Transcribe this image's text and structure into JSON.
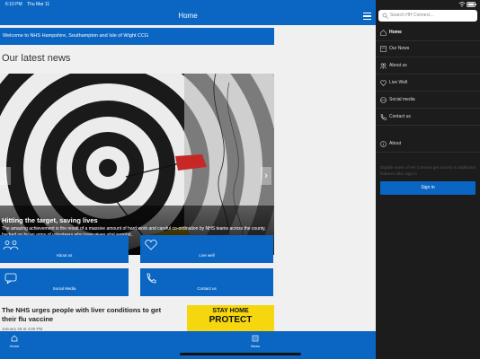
{
  "status": {
    "time": "6:10 PM",
    "date": "Thu Mar 11"
  },
  "navbar": {
    "title": "Home"
  },
  "welcome": "Welcome to NHS Hampshire, Southampton and Isle of Wight CCG",
  "section_title": "Our latest news",
  "hero": {
    "title": "Hitting the target, saving lives",
    "description": "The amazing achievement is the result of a massive amount of hard work and careful co-ordination by NHS teams across the county, backed up by an army of volunteers who have given vital support."
  },
  "tiles": {
    "about": "About us",
    "live": "Live well",
    "social": "Social Media",
    "contact": "Contact us"
  },
  "news_item": {
    "title": "The NHS urges people with liver conditions to get their flu vaccine",
    "date": "January 28 at 4:00 PM",
    "thumb_line1": "STAY HOME",
    "thumb_line2": "PROTECT"
  },
  "tabbar": {
    "home": "Home",
    "news": "News"
  },
  "drawer": {
    "search_placeholder": "Search HH Connect...",
    "items": {
      "home": "Home",
      "news": "Our News",
      "about_us": "About us",
      "live_well": "Live Well",
      "social": "Social media",
      "contact": "Contact us",
      "about": "About"
    },
    "hint": "Eligible users of HH Connect get access to additional features after sign in",
    "signin": "Sign in"
  },
  "colors": {
    "brand": "#0a66c2",
    "drawer_bg": "#1c1c1c",
    "thumb": "#f5d60f"
  }
}
